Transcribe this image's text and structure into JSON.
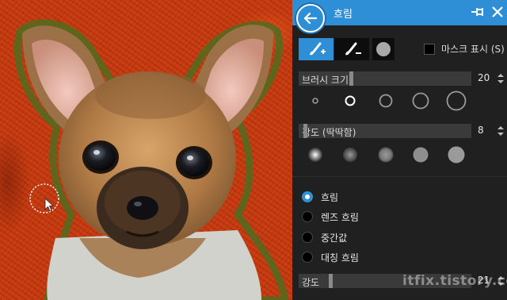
{
  "panel": {
    "title": "흐림",
    "mask_toggle_label": "마스크 표시 (S)",
    "mask_toggle_checked": false,
    "brush_size": {
      "label": "브러시 크기",
      "value": "20",
      "level_percent": 30
    },
    "hardness": {
      "label": "강도 (딱딱함)",
      "value": "8",
      "level_percent": 3
    },
    "strength": {
      "label": "강도",
      "value": "21",
      "level_percent": 18
    },
    "brush_size_presets": [
      "size-1",
      "size-2",
      "size-3",
      "size-4",
      "size-5"
    ],
    "selected_brush_size_preset": 1,
    "hardness_presets": [
      "hard-1",
      "hard-2",
      "hard-3",
      "hard-4",
      "hard-5"
    ],
    "modes": [
      {
        "label": "흐림",
        "selected": true
      },
      {
        "label": "렌즈 흐림",
        "selected": false
      },
      {
        "label": "중간값",
        "selected": false
      },
      {
        "label": "대칭 흐림",
        "selected": false
      }
    ],
    "icons": {
      "back": "back-arrow-icon",
      "pin": "pin-icon",
      "close": "close-icon",
      "brush_add": "brush-plus-icon",
      "brush_erase": "brush-minus-icon",
      "circle_tool": "circle-icon"
    }
  },
  "watermark": "itfix.tistory.com",
  "colors": {
    "accent": "#2f8fd6",
    "panel_bg": "#202020",
    "slider_bg": "#3a3a3a",
    "background_red": "#c53a10"
  }
}
